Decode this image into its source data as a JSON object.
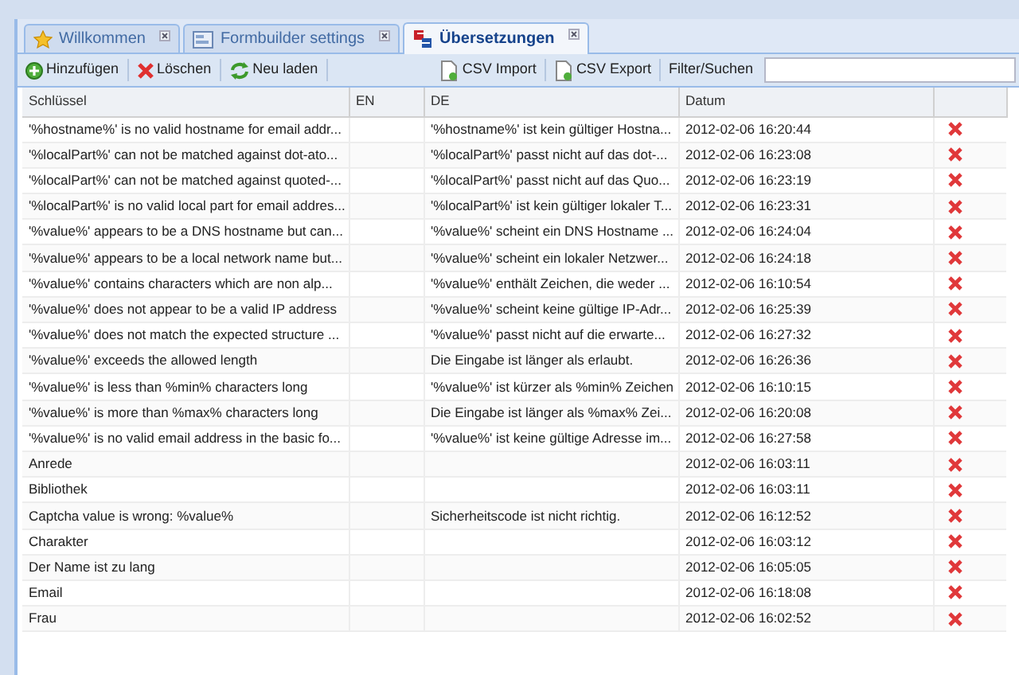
{
  "tabs": [
    {
      "label": "Willkommen",
      "selected": false
    },
    {
      "label": "Formbuilder settings",
      "selected": false
    },
    {
      "label": "Übersetzungen",
      "selected": true
    }
  ],
  "toolbar": {
    "left": [
      {
        "label": "Hinzufügen"
      },
      {
        "label": "Löschen"
      },
      {
        "label": "Neu laden"
      }
    ],
    "right": [
      {
        "label": "CSV Import"
      },
      {
        "label": "CSV Export"
      }
    ],
    "filter_label": "Filter/Suchen"
  },
  "table": {
    "columns": [
      "Schlüssel",
      "EN",
      "DE",
      "Datum"
    ],
    "rows": [
      {
        "key": "'%hostname%' is no valid hostname for email addr...",
        "de": "'%hostname%' ist kein gültiger Hostna...",
        "date": "2012-02-06 16:20:44"
      },
      {
        "key": "'%localPart%' can not be matched against dot-ato...",
        "de": "'%localPart%' passt nicht auf das dot-...",
        "date": "2012-02-06 16:23:08"
      },
      {
        "key": "'%localPart%' can not be matched against quoted-...",
        "de": "'%localPart%' passt nicht auf das Quo...",
        "date": "2012-02-06 16:23:19"
      },
      {
        "key": "'%localPart%' is no valid local part for email addres...",
        "de": "'%localPart%' ist kein gültiger lokaler T...",
        "date": "2012-02-06 16:23:31"
      },
      {
        "key": "'%value%' appears to be a DNS hostname but can...",
        "de": "'%value%' scheint ein DNS Hostname ...",
        "date": "2012-02-06 16:24:04"
      },
      {
        "key": "'%value%' appears to be a local network name but...",
        "de": "'%value%' scheint ein lokaler Netzwer...",
        "date": "2012-02-06 16:24:18"
      },
      {
        "key": "'%value%' contains characters which are non alp...",
        "de": "'%value%' enthält Zeichen, die weder ...",
        "date": "2012-02-06 16:10:54"
      },
      {
        "key": "'%value%' does not appear to be a valid IP address",
        "de": "'%value%' scheint keine gültige IP-Adr...",
        "date": "2012-02-06 16:25:39"
      },
      {
        "key": "'%value%' does not match the expected structure ...",
        "de": "'%value%' passt nicht auf die erwarte...",
        "date": "2012-02-06 16:27:32"
      },
      {
        "key": "'%value%' exceeds the allowed length",
        "de": "Die Eingabe ist länger als erlaubt.",
        "date": "2012-02-06 16:26:36"
      },
      {
        "key": "'%value%' is less than %min% characters long",
        "de": "'%value%' ist kürzer als %min% Zeichen",
        "date": "2012-02-06 16:10:15"
      },
      {
        "key": "'%value%' is more than %max% characters long",
        "de": "Die Eingabe ist länger als %max% Zei...",
        "date": "2012-02-06 16:20:08"
      },
      {
        "key": "'%value%' is no valid email address in the basic fo...",
        "de": "'%value%' ist keine gültige Adresse im...",
        "date": "2012-02-06 16:27:58"
      },
      {
        "key": "Anrede",
        "date": "2012-02-06 16:03:11"
      },
      {
        "key": "Bibliothek",
        "date": "2012-02-06 16:03:11"
      },
      {
        "key": "Captcha value is wrong: %value%",
        "de": "Sicherheitscode ist nicht richtig.",
        "date": "2012-02-06 16:12:52"
      },
      {
        "key": "Charakter",
        "date": "2012-02-06 16:03:12"
      },
      {
        "key": "Der Name ist zu lang",
        "date": "2012-02-06 16:05:05"
      },
      {
        "key": "Email",
        "date": "2012-02-06 16:18:08"
      },
      {
        "key": "Frau",
        "date": "2012-02-06 16:02:52"
      }
    ]
  }
}
